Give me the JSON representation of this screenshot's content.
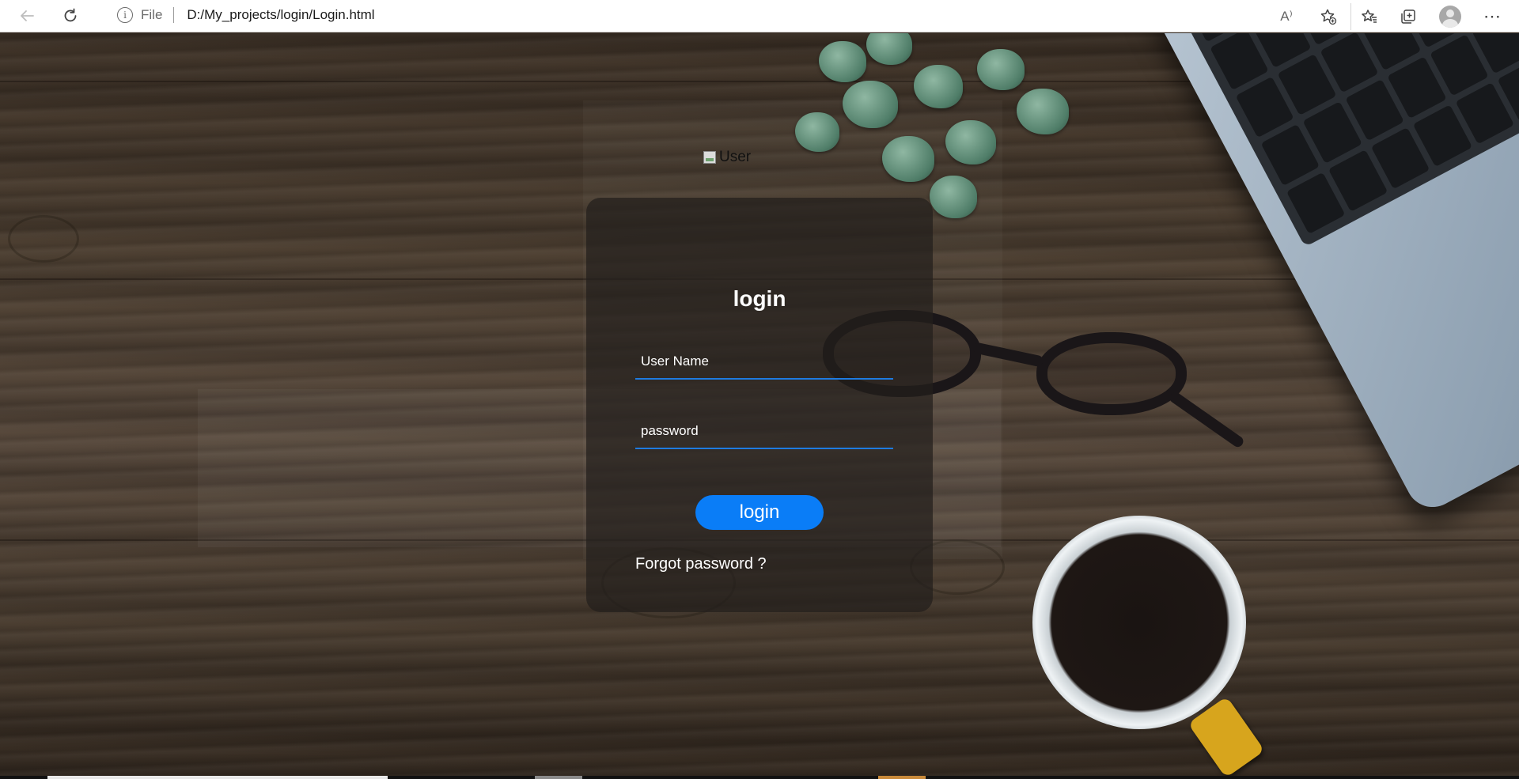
{
  "browser": {
    "address_scheme": "File",
    "address_url": "D:/My_projects/login/Login.html",
    "icons": {
      "back": "back-arrow-icon",
      "reload": "reload-icon",
      "info": "info-icon",
      "read_aloud": "read-aloud-icon",
      "add_favorite": "add-favorite-icon",
      "favorites": "favorites-icon",
      "collections": "collections-icon",
      "profile": "profile-avatar-icon",
      "more": "more-options-icon"
    },
    "read_aloud_glyph": "A⁾",
    "more_glyph": "⋯"
  },
  "page": {
    "user_image_alt": "User",
    "login_card": {
      "title": "login",
      "username_placeholder": "User Name",
      "password_placeholder": "password",
      "login_button": "login",
      "forgot_password": "Forgot password ?"
    },
    "colors": {
      "accent": "#0a7df7",
      "input_underline": "#1e7be0",
      "card_bg": "rgba(35,30,28,0.72)"
    }
  }
}
